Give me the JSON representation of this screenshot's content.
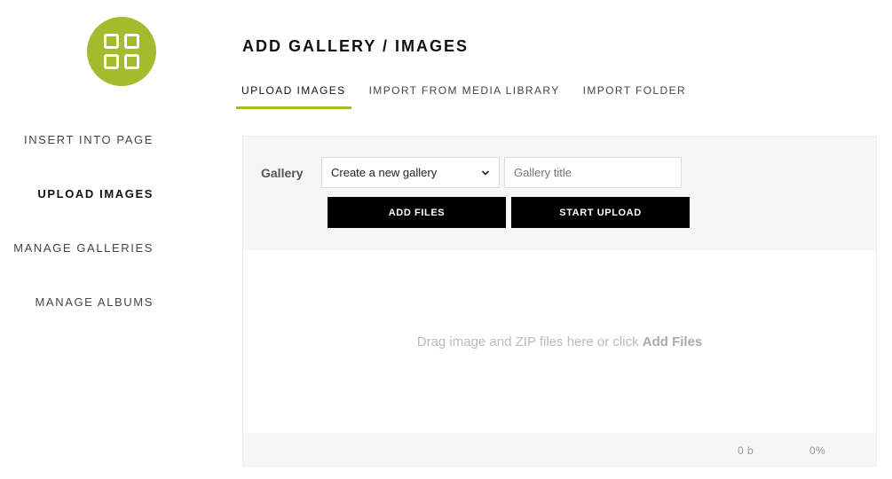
{
  "colors": {
    "accent": "#a2bc2e"
  },
  "sidebar": {
    "logo_icon": "grid-icon",
    "items": [
      {
        "label": "INSERT INTO PAGE",
        "active": false
      },
      {
        "label": "UPLOAD IMAGES",
        "active": true
      },
      {
        "label": "MANAGE GALLERIES",
        "active": false
      },
      {
        "label": "MANAGE ALBUMS",
        "active": false
      }
    ]
  },
  "main": {
    "title": "ADD GALLERY / IMAGES",
    "tabs": [
      {
        "label": "UPLOAD IMAGES",
        "active": true
      },
      {
        "label": "IMPORT FROM MEDIA LIBRARY",
        "active": false
      },
      {
        "label": "IMPORT FOLDER",
        "active": false
      }
    ],
    "upload": {
      "gallery_label": "Gallery",
      "gallery_select_value": "Create a new gallery",
      "gallery_title_placeholder": "Gallery title",
      "add_files_label": "ADD FILES",
      "start_upload_label": "START UPLOAD",
      "drop_text": "Drag image and ZIP files here or click",
      "drop_link": "Add Files",
      "size_text": "0 b",
      "percent_text": "0%"
    }
  }
}
